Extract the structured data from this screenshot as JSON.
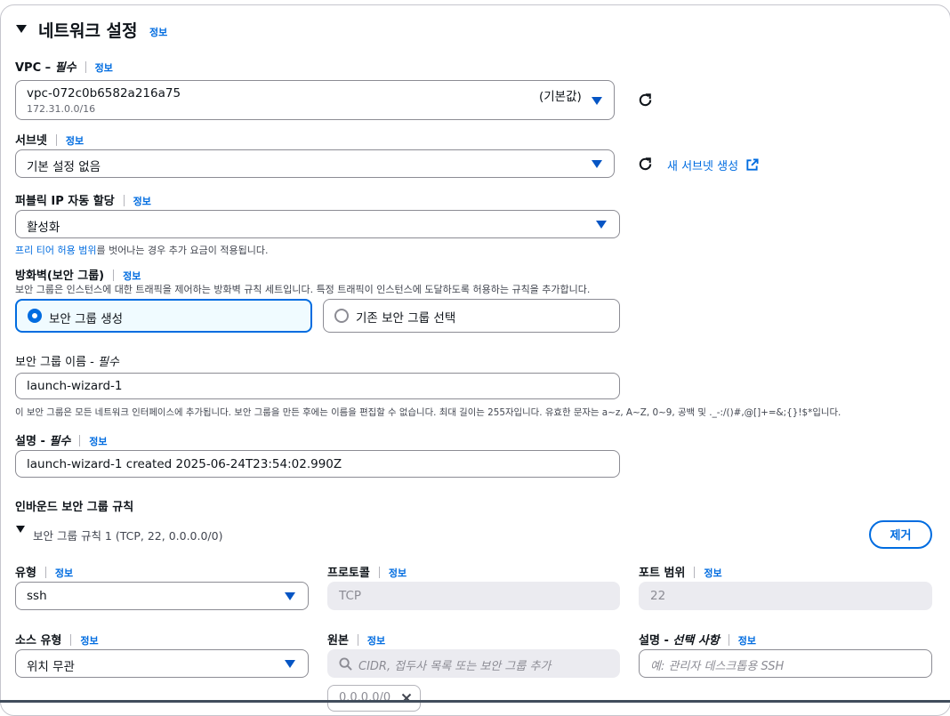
{
  "section": {
    "title": "네트워크 설정",
    "info": "정보"
  },
  "vpc": {
    "label": "VPC – ",
    "label_req": "필수",
    "info": "정보",
    "value": "vpc-072c0b6582a216a75",
    "default_tag": "(기본값)",
    "cidr": "172.31.0.0/16"
  },
  "subnet": {
    "label": "서브넷",
    "info": "정보",
    "value": "기본 설정 없음",
    "new_link": "새 서브넷 생성"
  },
  "public_ip": {
    "label": "퍼블릭 IP 자동 할당",
    "info": "정보",
    "value": "활성화",
    "help_link": "프리 티어 허용 범위",
    "help_rest": "를 벗어나는 경우 추가 요금이 적용됩니다."
  },
  "firewall": {
    "label": "방화벽(보안 그룹)",
    "info": "정보",
    "desc": "보안 그룹은 인스턴스에 대한 트래픽을 제어하는 방화벽 규칙 세트입니다. 특정 트래픽이 인스턴스에 도달하도록 허용하는 규칙을 추가합니다.",
    "option_create": "보안 그룹 생성",
    "option_existing": "기존 보안 그룹 선택"
  },
  "sg_name": {
    "label": "보안 그룹 이름 - ",
    "label_req": "필수",
    "value": "launch-wizard-1",
    "help": "이 보안 그룹은 모든 네트워크 인터페이스에 추가됩니다. 보안 그룹을 만든 후에는 이름을 편집할 수 없습니다. 최대 길이는 255자입니다. 유효한 문자는 a~z, A~Z, 0~9, 공백 및 ._-:/()#,@[]+=&;{}!$*입니다."
  },
  "description": {
    "label": "설명 - ",
    "label_req": "필수",
    "info": "정보",
    "value": "launch-wizard-1 created 2025-06-24T23:54:02.990Z"
  },
  "inbound": {
    "title": "인바운드 보안 그룹 규칙",
    "rule_title": "보안 그룹 규칙 1 (TCP, 22, 0.0.0.0/0)",
    "remove": "제거"
  },
  "rule": {
    "type": {
      "label": "유형",
      "info": "정보",
      "value": "ssh"
    },
    "protocol": {
      "label": "프로토콜",
      "info": "정보",
      "value": "TCP"
    },
    "port": {
      "label": "포트 범위",
      "info": "정보",
      "value": "22"
    },
    "source_type": {
      "label": "소스 유형",
      "info": "정보",
      "value": "위치 무관"
    },
    "source": {
      "label": "원본",
      "info": "정보",
      "placeholder": "CIDR, 접두사 목록 또는 보안 그룹 추가",
      "token": "0.0.0.0/0"
    },
    "desc": {
      "label": "설명 - ",
      "label_opt": "선택 사항",
      "info": "정보",
      "placeholder": "예: 관리자 데스크톱용 SSH"
    }
  },
  "colors": {
    "accent": "#006ce0",
    "selected_fill": "#f0fbff",
    "border": "#8c8c94"
  }
}
